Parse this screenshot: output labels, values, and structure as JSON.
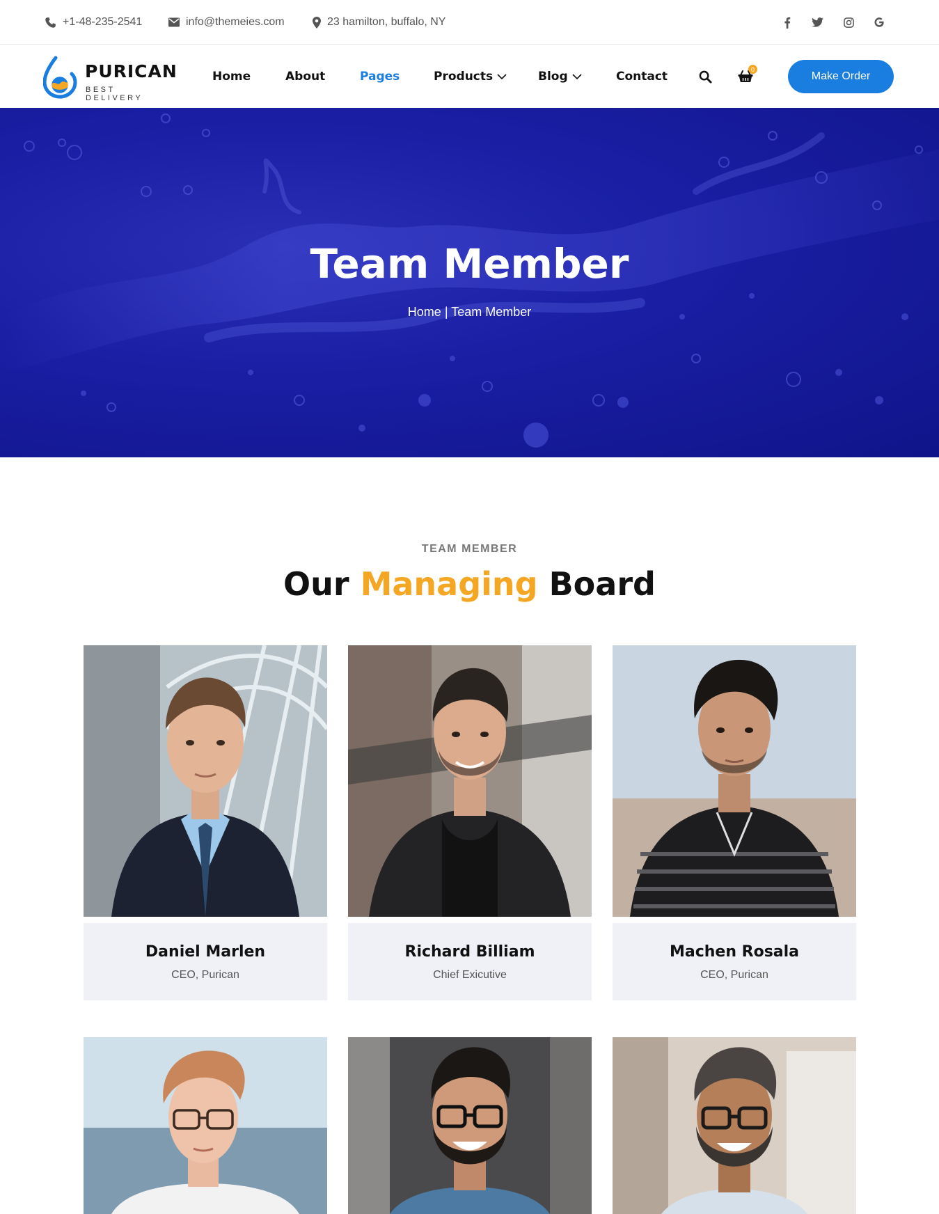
{
  "topbar": {
    "phone": "+1-48-235-2541",
    "email": "info@themeies.com",
    "address": "23 hamilton, buffalo, NY",
    "social_icons": [
      "facebook-icon",
      "twitter-icon",
      "instagram-icon",
      "google-icon"
    ]
  },
  "brand": {
    "name": "PURICAN",
    "tagline": "BEST DELIVERY",
    "accent_color": "#1a7de0",
    "highlight_color": "#f5a623"
  },
  "nav": {
    "items": [
      {
        "label": "Home"
      },
      {
        "label": "About"
      },
      {
        "label": "Pages"
      },
      {
        "label": "Products"
      },
      {
        "label": "Blog"
      },
      {
        "label": "Contact"
      }
    ],
    "active": "Pages",
    "cart_count": "0",
    "cta_label": "Make Order"
  },
  "hero": {
    "title": "Team Member",
    "breadcrumb_home": "Home",
    "breadcrumb_sep": "|",
    "breadcrumb_current": "Team Member"
  },
  "section": {
    "kicker": "TEAM MEMBER",
    "title_part1": "Our",
    "title_accent": "Managing",
    "title_part2": "Board"
  },
  "team": [
    {
      "name": "Daniel Marlen",
      "role": "CEO, Purican"
    },
    {
      "name": "Richard Billiam",
      "role": "Chief Exicutive"
    },
    {
      "name": "Machen Rosala",
      "role": "CEO, Purican"
    },
    {
      "name": "",
      "role": ""
    },
    {
      "name": "",
      "role": ""
    },
    {
      "name": "",
      "role": ""
    }
  ]
}
